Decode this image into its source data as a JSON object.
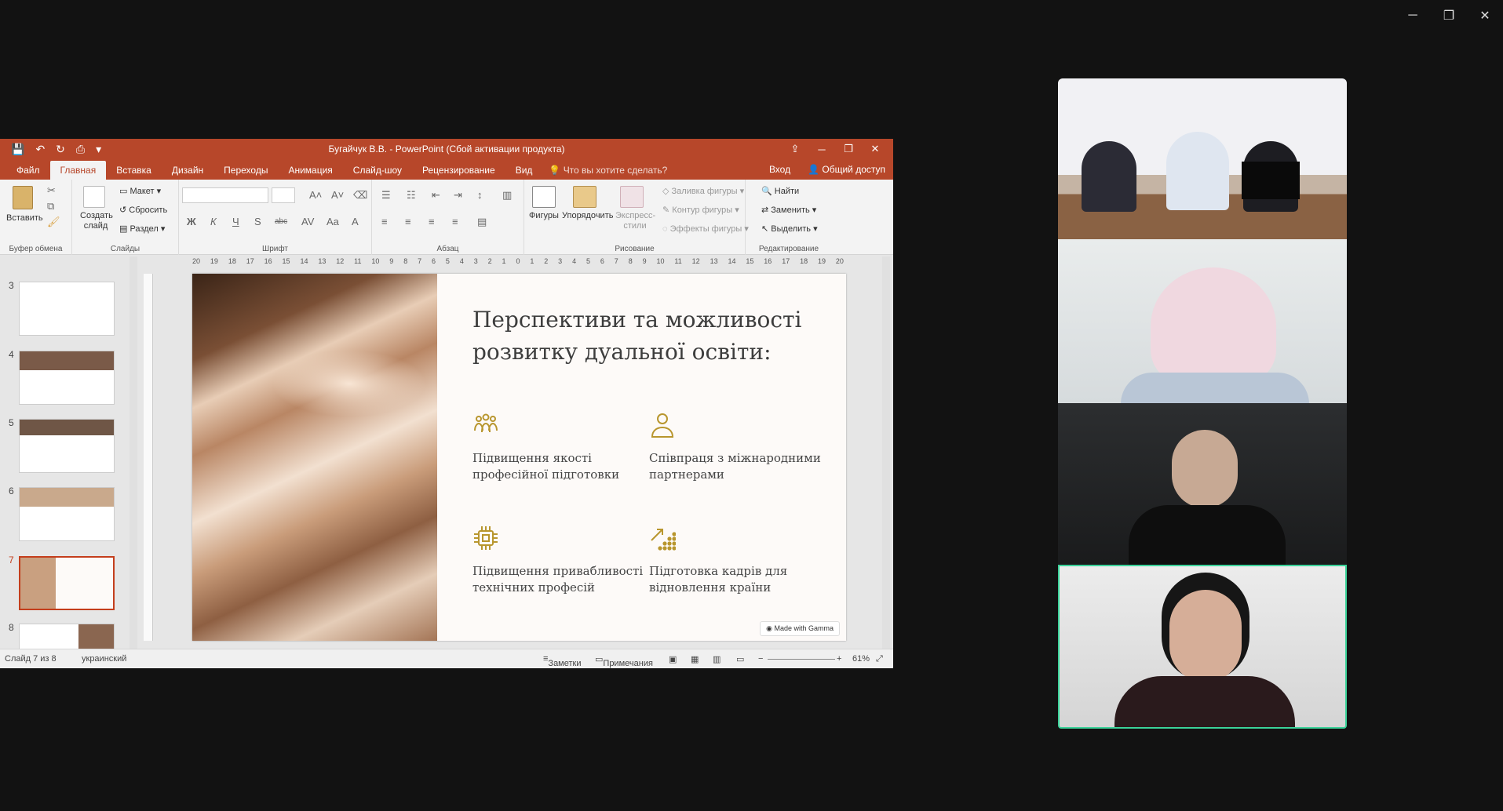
{
  "window": {
    "minimize": "─",
    "restore": "❐",
    "close": "✕"
  },
  "ppt": {
    "title": "Бугайчук В.В. - PowerPoint (Сбой активации продукта)",
    "qat": [
      "💾",
      "↶",
      "↻",
      "⎙",
      "▾"
    ],
    "title_controls": [
      "⇪",
      "─",
      "❐",
      "✕"
    ],
    "tabs": [
      "Файл",
      "Главная",
      "Вставка",
      "Дизайн",
      "Переходы",
      "Анимация",
      "Слайд-шоу",
      "Рецензирование",
      "Вид"
    ],
    "tellme": "Что вы хотите сделать?",
    "login": "Вход",
    "share": "Общий доступ",
    "ribbon": {
      "paste": "Вставить",
      "clipboard_label": "Буфер обмена",
      "create_slide": "Создать слайд",
      "layout": "Макет",
      "reset": "Сбросить",
      "section": "Раздел",
      "slides_label": "Слайды",
      "font_label": "Шрифт",
      "para_label": "Абзац",
      "shapes": "Фигуры",
      "arrange": "Упорядочить",
      "express": "Экспресс-стили",
      "fill": "Заливка фигуры",
      "outline": "Контур фигуры",
      "effects": "Эффекты фигуры",
      "drawing_label": "Рисование",
      "find": "Найти",
      "replace": "Заменить",
      "select": "Выделить",
      "edit_label": "Редактирование",
      "bold": "Ж",
      "italic": "К",
      "underline": "Ч",
      "strike": "S",
      "abc": "abc",
      "av": "AV",
      "aa": "Aa",
      "fontcolor": "A"
    },
    "ruler": [
      "20",
      "19",
      "18",
      "17",
      "16",
      "15",
      "14",
      "13",
      "12",
      "11",
      "10",
      "9",
      "8",
      "7",
      "6",
      "5",
      "4",
      "3",
      "2",
      "1",
      "0",
      "1",
      "2",
      "3",
      "4",
      "5",
      "6",
      "7",
      "8",
      "9",
      "10",
      "11",
      "12",
      "13",
      "14",
      "15",
      "16",
      "17",
      "18",
      "19",
      "20"
    ],
    "thumbs": [
      "3",
      "4",
      "5",
      "6",
      "7",
      "8"
    ],
    "slide": {
      "title": "Перспективи та можливості розвитку дуальної освіти:",
      "features": [
        "Підвищення якості професійної підготовки",
        "Співпраця з міжнародними партнерами",
        "Підвищення привабливості технічних професій",
        "Підготовка кадрів для відновлення країни"
      ],
      "badge": "Made with Gamma"
    },
    "status": {
      "slide_of": "Слайд 7 из 8",
      "lang": "украинский",
      "notes": "Заметки",
      "comments": "Примечания",
      "zoom": "61%"
    }
  },
  "colors": {
    "accent": "#b7472a",
    "gold": "#b8962e",
    "tile_active": "#3bd39a"
  }
}
